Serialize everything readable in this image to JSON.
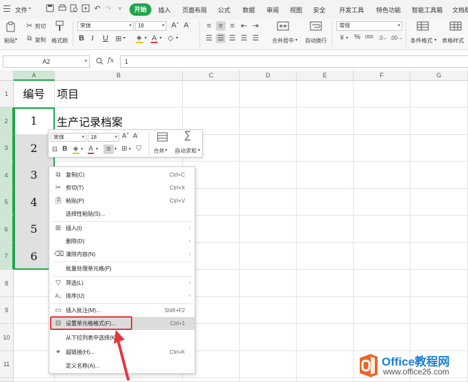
{
  "menubar": {
    "file": "文件",
    "tabs": [
      "开始",
      "插入",
      "页面布局",
      "公式",
      "数据",
      "审阅",
      "视图",
      "安全",
      "开发工具",
      "特色功能",
      "智能工具箱",
      "文档助"
    ],
    "active_tab": "开始",
    "active_color": "#1fa64a"
  },
  "ribbon": {
    "paste": "粘贴",
    "cut": "剪切",
    "copy": "复制",
    "format_painter": "格式刷",
    "font_name": "宋体",
    "font_size": "18",
    "bold": "B",
    "italic": "I",
    "underline": "U",
    "merge_center": "合并居中",
    "wrap_text": "自动换行",
    "number_format": "常规",
    "percent": "%",
    "thousands": "000",
    "conditional_format": "条件格式",
    "table_style": "表格样式"
  },
  "formula_bar": {
    "cell_ref": "A2",
    "fx": "fx",
    "value": "1"
  },
  "sheet": {
    "columns": [
      "A",
      "B",
      "C",
      "D",
      "E",
      "F",
      "G"
    ],
    "rows": [
      "1",
      "2",
      "3",
      "4",
      "5",
      "6",
      "7",
      "8",
      "9",
      "10",
      "11"
    ],
    "cells": {
      "a1": "编号",
      "b1": "项目",
      "a2": "1",
      "b2": "生产记录档案",
      "a3": "2",
      "a4": "3",
      "a5": "4",
      "a6": "5",
      "a7": "6"
    },
    "selection_color": "#1fa64a"
  },
  "mini_toolbar": {
    "font_name": "宋体",
    "font_size": "18",
    "bold": "B",
    "merge": "合并",
    "autosum": "自动求和"
  },
  "context_menu": {
    "items": [
      {
        "label": "复制(C)",
        "shortcut": "Ctrl+C",
        "icon": "copy-icon"
      },
      {
        "label": "剪切(T)",
        "shortcut": "Ctrl+X",
        "icon": "scissors-icon"
      },
      {
        "label": "粘贴(P)",
        "shortcut": "Ctrl+V",
        "icon": "paste-icon"
      },
      {
        "label": "选择性粘贴(S)...",
        "shortcut": "",
        "icon": ""
      },
      {
        "label": "插入(I)",
        "shortcut": "",
        "icon": "insert-icon"
      },
      {
        "label": "删除(D)",
        "shortcut": "",
        "icon": ""
      },
      {
        "label": "清除内容(N)",
        "shortcut": "",
        "icon": "eraser-icon"
      },
      {
        "label": "批量处理单元格(P)",
        "shortcut": "",
        "icon": ""
      },
      {
        "label": "筛选(L)",
        "shortcut": "",
        "icon": "filter-icon"
      },
      {
        "label": "排序(U)",
        "shortcut": "",
        "icon": "sort-icon"
      },
      {
        "label": "插入批注(M)...",
        "shortcut": "Shift+F2",
        "icon": "comment-icon"
      },
      {
        "label": "设置单元格格式(F)...",
        "shortcut": "Ctrl+1",
        "icon": "format-cells-icon"
      },
      {
        "label": "从下拉列表中选择(K)...",
        "shortcut": "",
        "icon": ""
      },
      {
        "label": "超链接(H)...",
        "shortcut": "Ctrl+K",
        "icon": "link-icon"
      },
      {
        "label": "定义名称(A)...",
        "shortcut": "",
        "icon": ""
      }
    ],
    "highlighted": "设置单元格格式(F)...",
    "annotation_color": "#e8353a"
  },
  "watermark": {
    "brand": "Office教程网",
    "url": "www.office26.com",
    "brand_color": "#1a7fd4",
    "logo_color": "#e8672a"
  }
}
